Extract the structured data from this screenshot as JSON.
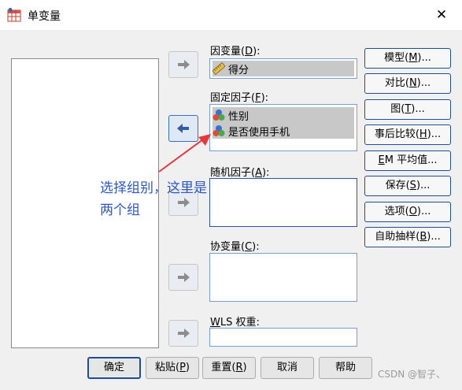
{
  "window": {
    "title": "单变量",
    "close_glyph": "✕"
  },
  "fields": {
    "dependent": {
      "label_pre": "因变量(",
      "mnemonic": "D",
      "label_post": "):",
      "item": "得分"
    },
    "fixed": {
      "label_pre": "固定因子(",
      "mnemonic": "F",
      "label_post": "):",
      "items": [
        "性别",
        "是否使用手机"
      ]
    },
    "random": {
      "label_pre": "随机因子(",
      "mnemonic": "A",
      "label_post": "):"
    },
    "covariate": {
      "label_pre": "协变量(",
      "mnemonic": "C",
      "label_post": "):"
    },
    "wls": {
      "label_pre": "",
      "mnemonic": "W",
      "label_post": "LS 权重:"
    }
  },
  "right_buttons": [
    {
      "pre": "模型(",
      "mn": "M",
      "post": ")..."
    },
    {
      "pre": "对比(",
      "mn": "N",
      "post": ")..."
    },
    {
      "pre": "图(",
      "mn": "T",
      "post": ")..."
    },
    {
      "pre": "事后比较(",
      "mn": "H",
      "post": ")..."
    },
    {
      "pre": "",
      "mn": "E",
      "post": "M 平均值..."
    },
    {
      "pre": "保存(",
      "mn": "S",
      "post": ")..."
    },
    {
      "pre": "选项(",
      "mn": "O",
      "post": ")..."
    },
    {
      "pre": "自助抽样(",
      "mn": "B",
      "post": ")..."
    }
  ],
  "bottom_buttons": [
    {
      "pre": "确定",
      "mn": "",
      "post": ""
    },
    {
      "pre": "粘贴(",
      "mn": "P",
      "post": ")"
    },
    {
      "pre": "重置(",
      "mn": "R",
      "post": ")"
    },
    {
      "pre": "取消",
      "mn": "",
      "post": ""
    },
    {
      "pre": "帮助",
      "mn": "",
      "post": ""
    }
  ],
  "annotation": {
    "line1": "选择组别，这里是",
    "line2": "两个组",
    "color": "#2b57c8",
    "arrow_color": "#e8373a"
  },
  "watermark": "CSDN @智子、",
  "colors": {
    "accent": "#1f4e96",
    "selection": "#c8c8c8",
    "dialog_bg": "#f0f0f0"
  }
}
